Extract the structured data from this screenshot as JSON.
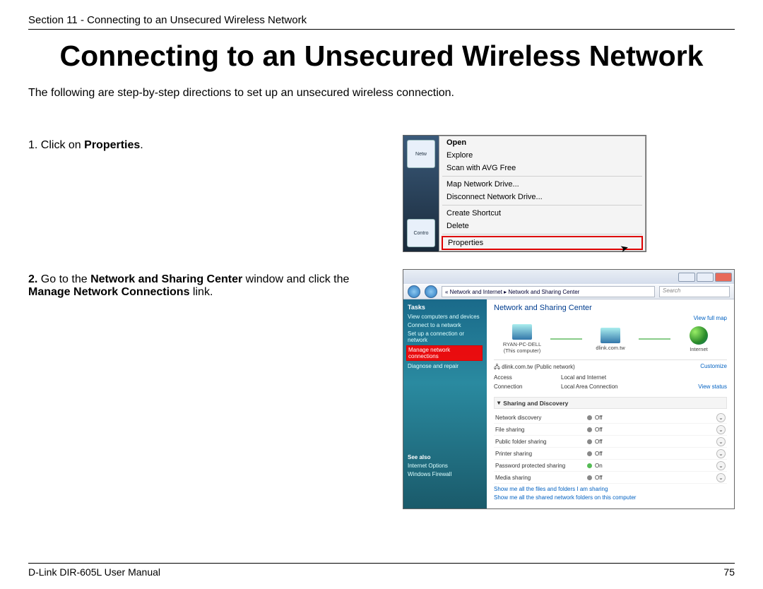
{
  "header": {
    "section_line": "Section 11 - Connecting to an Unsecured Wireless Network"
  },
  "title": "Connecting to an Unsecured Wireless Network",
  "intro": "The following are step-by-step directions to set up an unsecured wireless connection.",
  "step1": {
    "prefix": "1. Click on ",
    "bold": "Properties",
    "suffix": ".",
    "menu": {
      "open": "Open",
      "explore": "Explore",
      "scan": "Scan with AVG Free",
      "map": "Map Network Drive...",
      "disc": "Disconnect Network Drive...",
      "shortcut": "Create Shortcut",
      "delete": "Delete",
      "properties": "Properties"
    },
    "desktop": {
      "network_label": "Netw",
      "control_label": "Contro"
    }
  },
  "step2": {
    "prefix": "2. ",
    "p1": "Go to the ",
    "b1": "Network and Sharing Center",
    "p2": " window and click the ",
    "b2": "Manage Network Connections",
    "p3": " link.",
    "toolbar": {
      "breadcrumb": "« Network and Internet  ▸  Network and Sharing Center",
      "search": "Search"
    },
    "sidebar": {
      "tasks": "Tasks",
      "t1": "View computers and devices",
      "t2": "Connect to a network",
      "t3": "Set up a connection or network",
      "t4": "Manage network connections",
      "t5": "Diagnose and repair",
      "seealso": "See also",
      "s1": "Internet Options",
      "s2": "Windows Firewall"
    },
    "main": {
      "title": "Network and Sharing Center",
      "fullmap": "View full map",
      "nodes": {
        "pc": "RYAN-PC-DELL",
        "pc_sub": "(This computer)",
        "router": "dlink.com.tw",
        "internet": "Internet"
      },
      "panel_net": "dlink.com.tw (Public network)",
      "customize": "Customize",
      "access_lbl": "Access",
      "access_val": "Local and Internet",
      "conn_lbl": "Connection",
      "conn_val": "Local Area Connection",
      "viewstatus": "View status",
      "sharing_hdr": "Sharing and Discovery",
      "items": [
        {
          "lbl": "Network discovery",
          "val": "Off",
          "on": false
        },
        {
          "lbl": "File sharing",
          "val": "Off",
          "on": false
        },
        {
          "lbl": "Public folder sharing",
          "val": "Off",
          "on": false
        },
        {
          "lbl": "Printer sharing",
          "val": "Off",
          "on": false
        },
        {
          "lbl": "Password protected sharing",
          "val": "On",
          "on": true
        },
        {
          "lbl": "Media sharing",
          "val": "Off",
          "on": false
        }
      ],
      "showme1": "Show me all the files and folders I am sharing",
      "showme2": "Show me all the shared network folders on this computer"
    }
  },
  "footer": {
    "left": "D-Link DIR-605L User Manual",
    "right": "75"
  }
}
